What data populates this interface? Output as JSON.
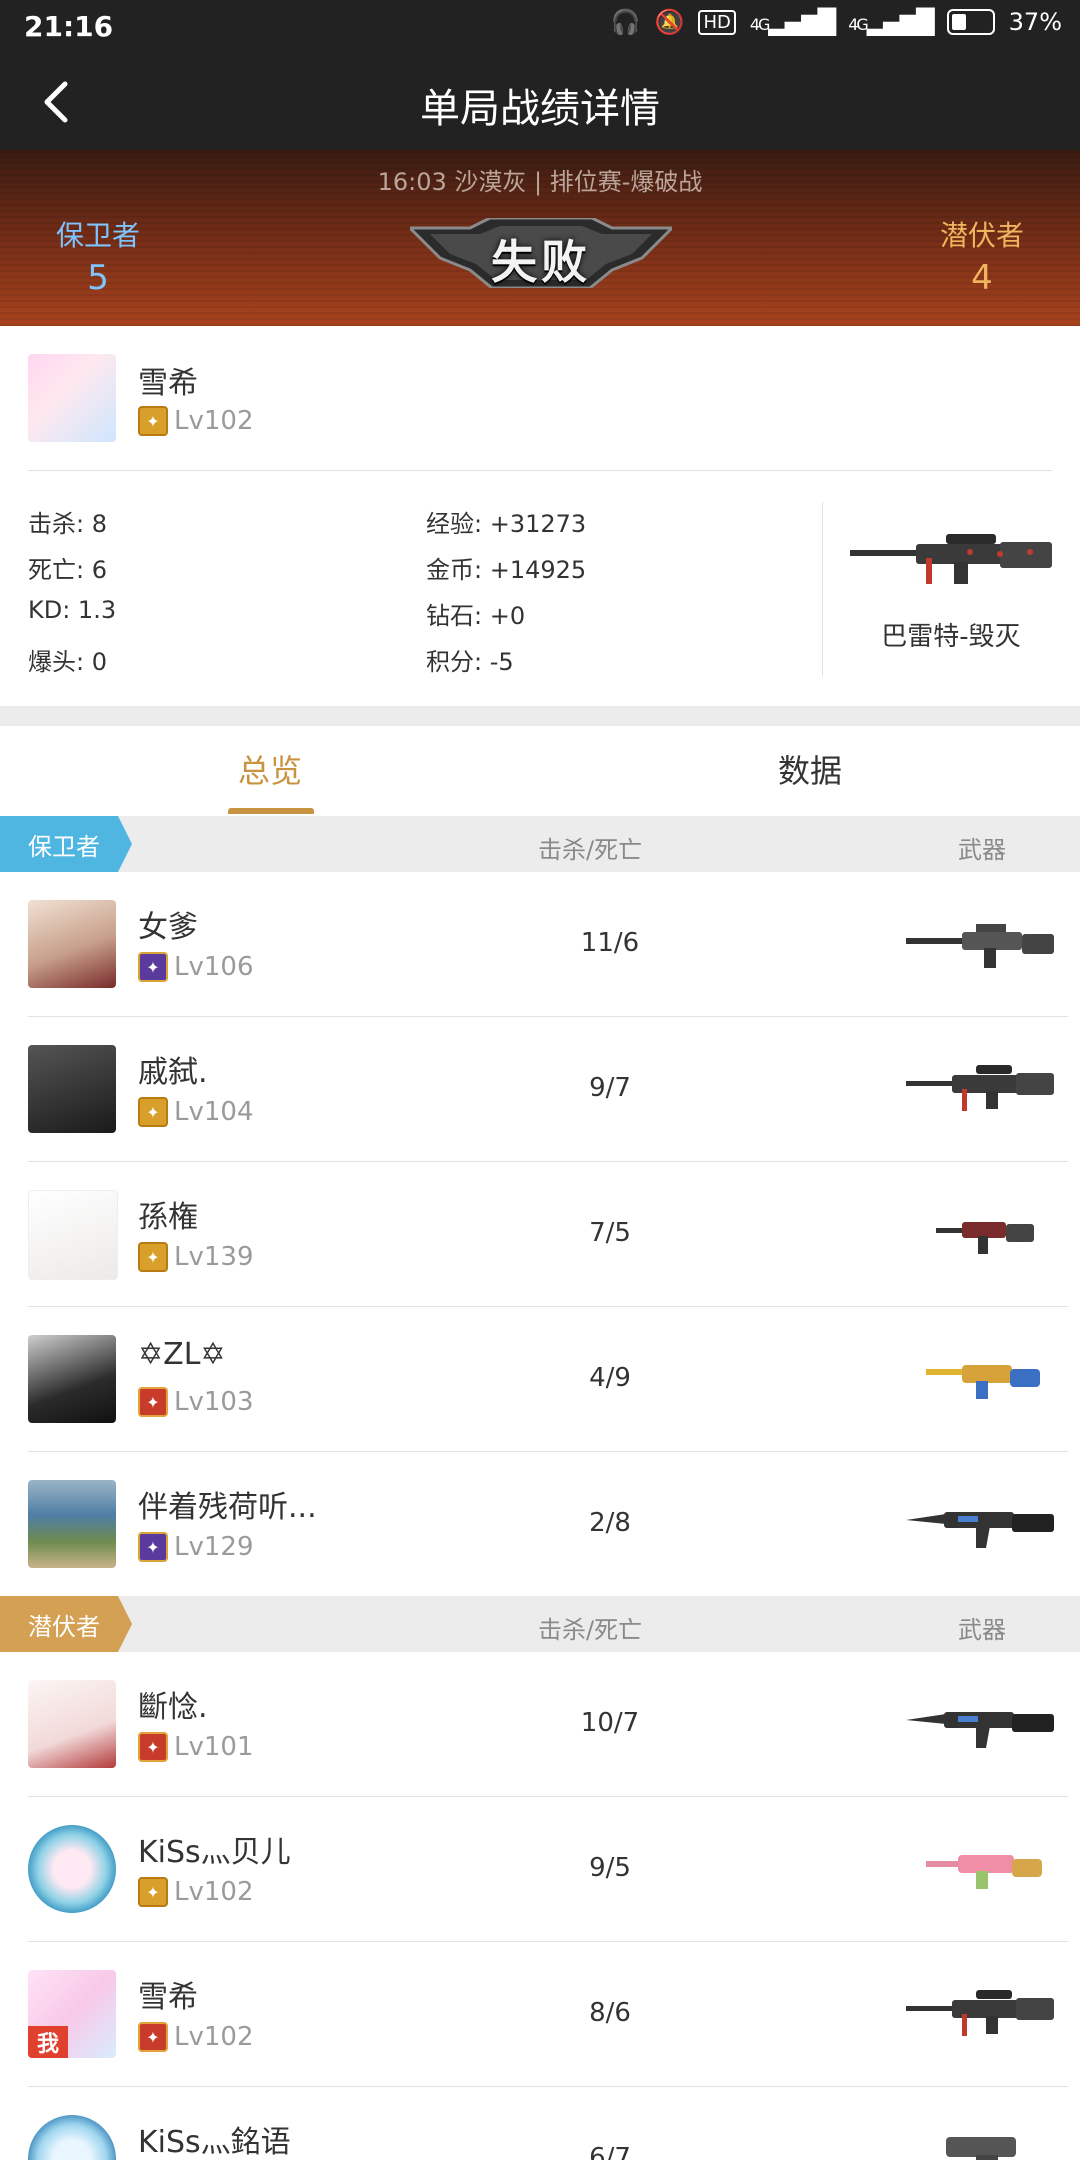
{
  "status_bar": {
    "time": "21:16",
    "battery": "37%",
    "net1": "4G",
    "net2": "4G",
    "hd": "HD"
  },
  "header": {
    "title": "单局战绩详情"
  },
  "match": {
    "info": "16:03 沙漠灰 | 排位赛-爆破战",
    "left_team": {
      "name": "保卫者",
      "score": "5"
    },
    "right_team": {
      "name": "潜伏者",
      "score": "4"
    },
    "result": "失败"
  },
  "player": {
    "name": "雪希",
    "level": "Lv102",
    "stats": {
      "kills": "击杀: 8",
      "deaths": "死亡: 6",
      "kd": "KD: 1.3",
      "headshots": "爆头: 0",
      "exp": "经验: +31273",
      "gold": "金币: +14925",
      "diamond": "钻石: +0",
      "points": "积分: -5"
    },
    "weapon": "巴雷特-毁灭"
  },
  "tabs": {
    "overview": "总览",
    "data": "数据"
  },
  "defenders": {
    "label": "保卫者",
    "col_kd": "击杀/死亡",
    "col_weapon": "武器",
    "rows": [
      {
        "name": "女爹",
        "level": "Lv106",
        "kd": "11/6"
      },
      {
        "name": "戚弑.",
        "level": "Lv104",
        "kd": "9/7"
      },
      {
        "name": "孫権",
        "level": "Lv139",
        "kd": "7/5"
      },
      {
        "name": "✡ZL✡",
        "level": "Lv103",
        "kd": "4/9"
      },
      {
        "name": "伴着残荷听...",
        "level": "Lv129",
        "kd": "2/8"
      }
    ]
  },
  "attackers": {
    "label": "潜伏者",
    "col_kd": "击杀/死亡",
    "col_weapon": "武器",
    "rows": [
      {
        "name": "斷惗.",
        "level": "Lv101",
        "kd": "10/7"
      },
      {
        "name": "KiSs灬贝儿",
        "level": "Lv102",
        "kd": "9/5"
      },
      {
        "name": "雪希",
        "level": "Lv102",
        "kd": "8/6",
        "me_badge": "我"
      },
      {
        "name": "KiSs灬銘语",
        "level": "",
        "kd": "6/7"
      }
    ]
  }
}
